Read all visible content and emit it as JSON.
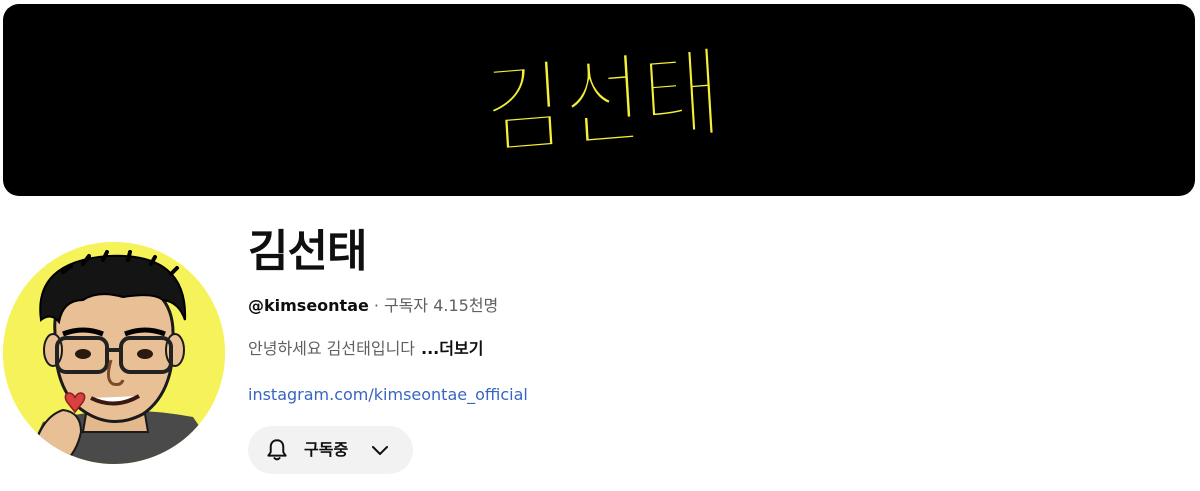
{
  "banner": {
    "logo_text": "김선태",
    "background_color": "#000000",
    "logo_color": "#f5ef38"
  },
  "channel": {
    "name": "김선태",
    "handle": "@kimseontae",
    "separator": "·",
    "subscribers": "구독자 4.15천명",
    "description": "안녕하세요 김선태입니다",
    "more_label": "...더보기",
    "link": "instagram.com/kimseontae_official"
  },
  "subscribe_button": {
    "label": "구독중",
    "icon": "bell-icon",
    "dropdown_icon": "chevron-down-icon"
  }
}
